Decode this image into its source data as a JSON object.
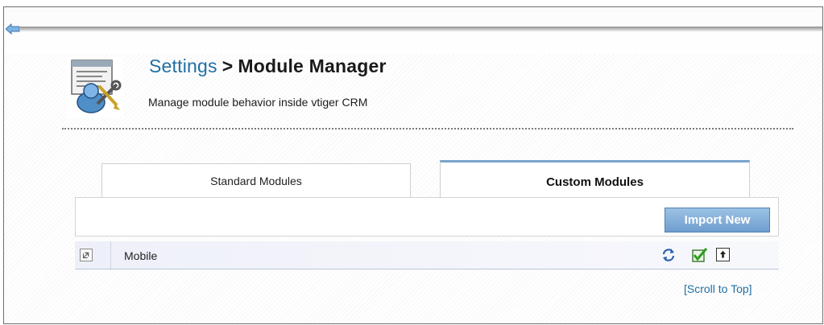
{
  "header": {
    "breadcrumb_link": "Settings",
    "breadcrumb_separator": ">",
    "page_title": "Module Manager",
    "description": "Manage module behavior inside vtiger CRM",
    "icon": "settings-tools-icon"
  },
  "tabs": [
    {
      "label": "Standard Modules",
      "active": false
    },
    {
      "label": "Custom Modules",
      "active": true
    }
  ],
  "toolbar": {
    "import_label": "Import New"
  },
  "modules": [
    {
      "name": "Mobile",
      "link_icon": "open-link-icon",
      "actions": [
        "refresh-icon",
        "enabled-check-icon",
        "export-icon"
      ]
    }
  ],
  "footer": {
    "scroll_top_label": "[Scroll to Top]"
  },
  "colors": {
    "link": "#206fa3",
    "button_top": "#9cc2e4",
    "button_bottom": "#6f9ecf",
    "active_tab_border": "#79a4cc",
    "check_green": "#2e9e1f"
  }
}
